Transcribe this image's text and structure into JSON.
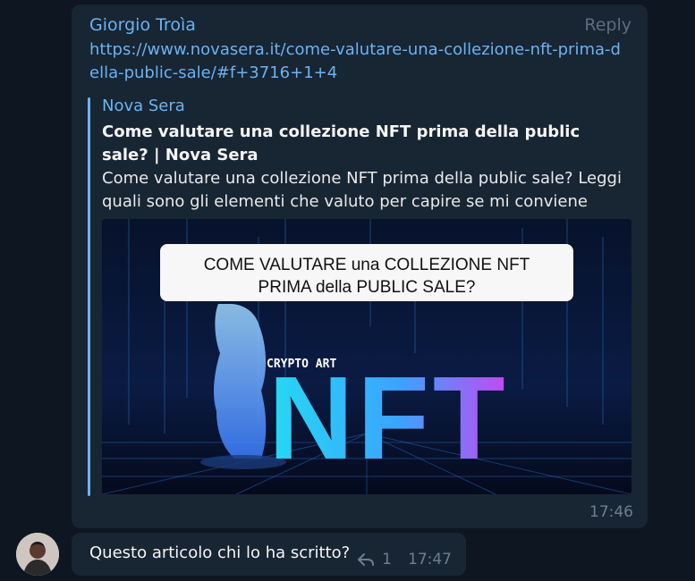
{
  "message": {
    "sender": "Giorgio Troìa",
    "reply_label": "Reply",
    "link": "https://www.novasera.it/come-valutare-una-collezione-nft-prima-della-public-sale/#f+3716+1+4",
    "time": "17:46",
    "preview": {
      "site": "Nova Sera",
      "title": "Come valutare una collezione NFT prima della public sale? | Nova Sera",
      "description": "Come valutare una collezione NFT prima della public sale? Leggi quali sono gli elementi che valuto per capire se mi conviene par...",
      "image": {
        "headline_line1": "COME VALUTARE una COLLEZIONE NFT",
        "headline_line2": "PRIMA della PUBLIC SALE?",
        "tag": "CRYPTO ART",
        "big_text": "NFT"
      }
    }
  },
  "reply_message": {
    "text": "Questo articolo chi lo ha scritto?",
    "reply_count": "1",
    "time": "17:47"
  },
  "colors": {
    "background": "#0e1621",
    "bubble": "#182533",
    "accent": "#6ab3f3"
  }
}
